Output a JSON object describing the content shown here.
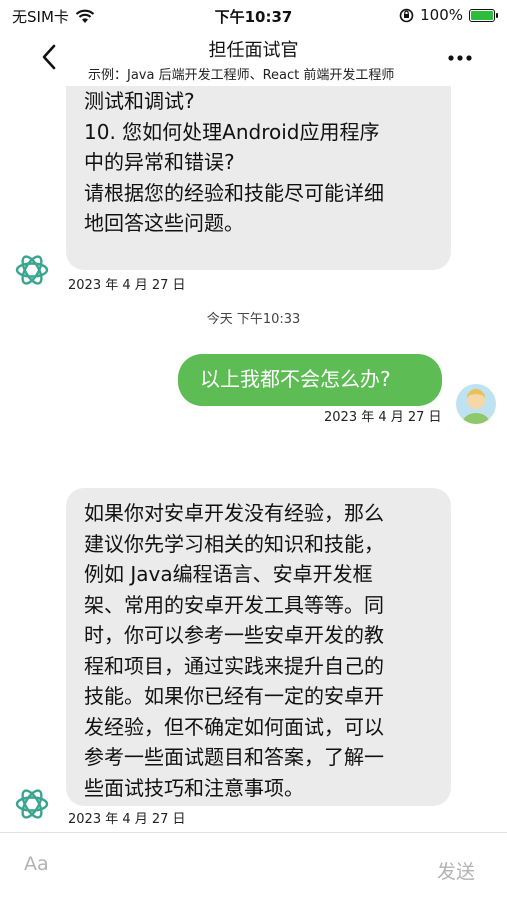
{
  "status_bar": {
    "carrier": "无SIM卡",
    "time": "下午10:37",
    "battery": "100%",
    "battery_level": 1.0
  },
  "nav": {
    "title": "担任面试官",
    "subtitle": "示例：Java 后端开发工程师、React 前端开发工程师"
  },
  "messages": {
    "ai_1": {
      "lines": [
        "测试和调试?",
        "10. 您如何处理Android应用程序",
        "中的异常和错误?",
        "",
        "请根据您的经验和技能尽可能详细",
        "地回答这些问题。"
      ],
      "timestamp": "2023 年 4 月 27 日"
    },
    "divider_time": "今天 下午10:33",
    "user_1": {
      "text": "以上我都不会怎么办?",
      "timestamp": "2023 年 4 月 27 日"
    },
    "ai_2": {
      "lines": [
        "如果你对安卓开发没有经验，那么",
        "建议你先学习相关的知识和技能，",
        "例如 Java编程语言、安卓开发框",
        "架、常用的安卓开发工具等等。同",
        "时，你可以参考一些安卓开发的教",
        "程和项目，通过实践来提升自己的",
        "技能。如果你已经有一定的安卓开",
        "发经验，但不确定如何面试，可以",
        "参考一些面试题目和答案，了解一",
        "些面试技巧和注意事项。"
      ],
      "timestamp": "2023 年 4 月 27 日"
    }
  },
  "input": {
    "placeholder": "Aa",
    "send_label": "发送"
  },
  "colors": {
    "user_bubble": "#5ebc55",
    "ai_bubble": "#ebebeb",
    "ai_logo": "#3aa58f"
  }
}
